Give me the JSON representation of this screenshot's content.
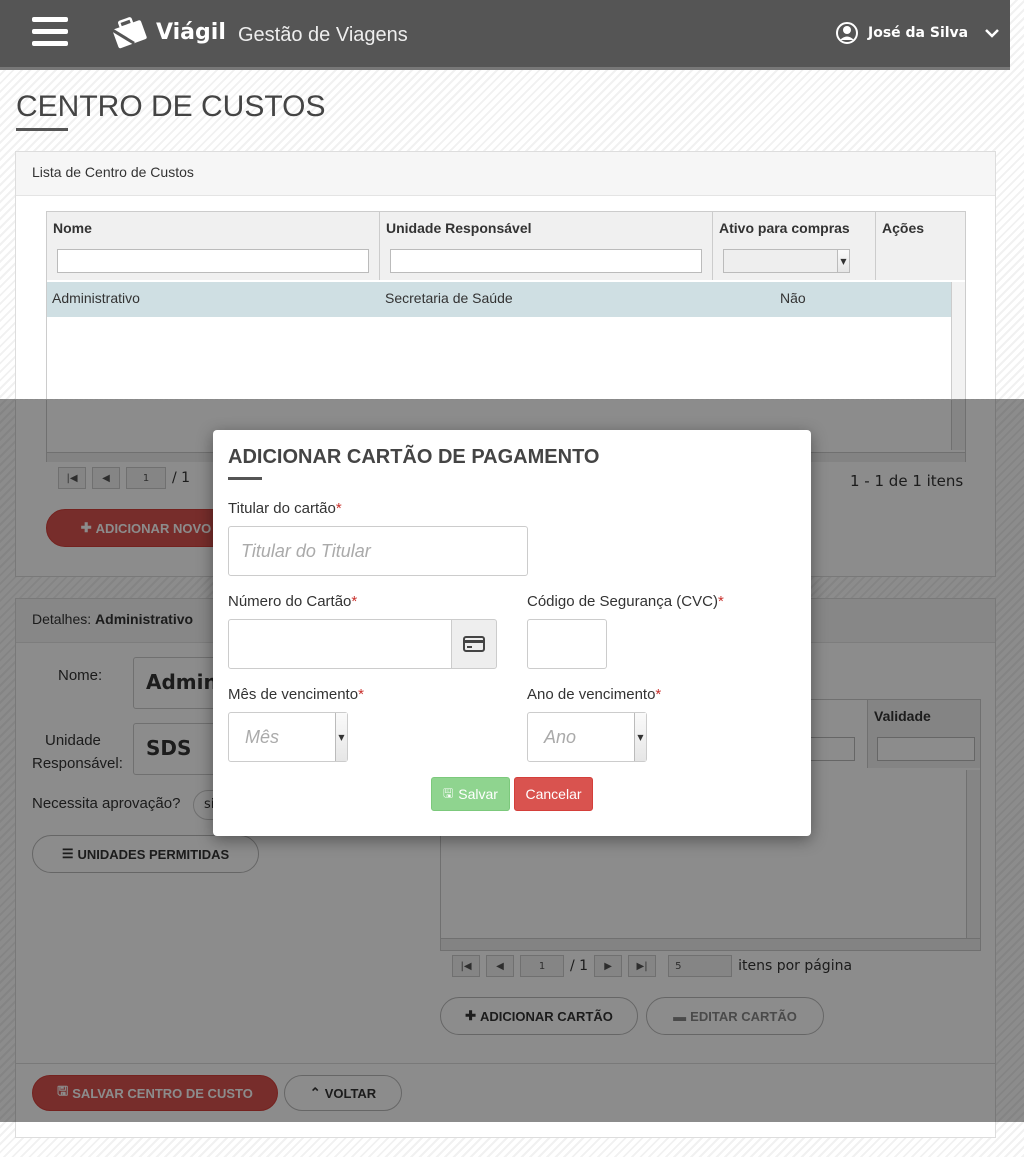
{
  "header": {
    "brand": "Viágil",
    "subtitle": "Gestão de Viagens",
    "user_name": "José da Silva"
  },
  "page": {
    "title": "CENTRO DE CUSTOS"
  },
  "list_panel": {
    "title": "Lista de Centro de Custos",
    "columns": [
      "Nome",
      "Unidade Responsável",
      "Ativo para compras",
      "Ações"
    ],
    "rows": [
      {
        "nome": "Administrativo",
        "unidade": "Secretaria de Saúde",
        "ativo": "Não"
      }
    ],
    "pager": {
      "page": "1",
      "of": "/ 1",
      "summary": "1 - 1 de 1 itens"
    },
    "add_button": "ADICIONAR NOVO"
  },
  "details_panel": {
    "prefix": "Detalhes:",
    "name": "Administrativo",
    "nome_label": "Nome:",
    "nome_value": "Adminis",
    "unidade_label_1": "Unidade",
    "unidade_label_2": "Responsável:",
    "unidade_value": "SDS",
    "aprovacao_label": "Necessita aprovação?",
    "aprovacao_value": "si",
    "unidades_button": "UNIDADES PERMITIDAS",
    "cards_grid": {
      "col_validade": "Validade",
      "pager_page": "1",
      "pager_of": "/ 1",
      "page_size": "5",
      "per_page_label": "itens por página"
    },
    "add_card_button": "ADICIONAR CARTÃO",
    "edit_card_button": "EDITAR CARTÃO"
  },
  "footer_buttons": {
    "save": "SALVAR CENTRO DE CUSTO",
    "back": "VOLTAR"
  },
  "modal": {
    "title": "ADICIONAR CARTÃO DE PAGAMENTO",
    "titular_label": "Titular do cartão",
    "titular_placeholder": "Titular do Titular",
    "numero_label": "Número do Cartão",
    "cvc_label": "Código de Segurança (CVC)",
    "mes_label": "Mês de vencimento",
    "mes_placeholder": "Mês",
    "ano_label": "Ano de vencimento",
    "ano_placeholder": "Ano",
    "required_mark": "*",
    "save_button": "Salvar",
    "cancel_button": "Cancelar"
  },
  "colors": {
    "topbar": "#555555",
    "accent_red": "#d9534f",
    "row_selected": "#cfdfe3",
    "save_green": "#8fd48f"
  }
}
